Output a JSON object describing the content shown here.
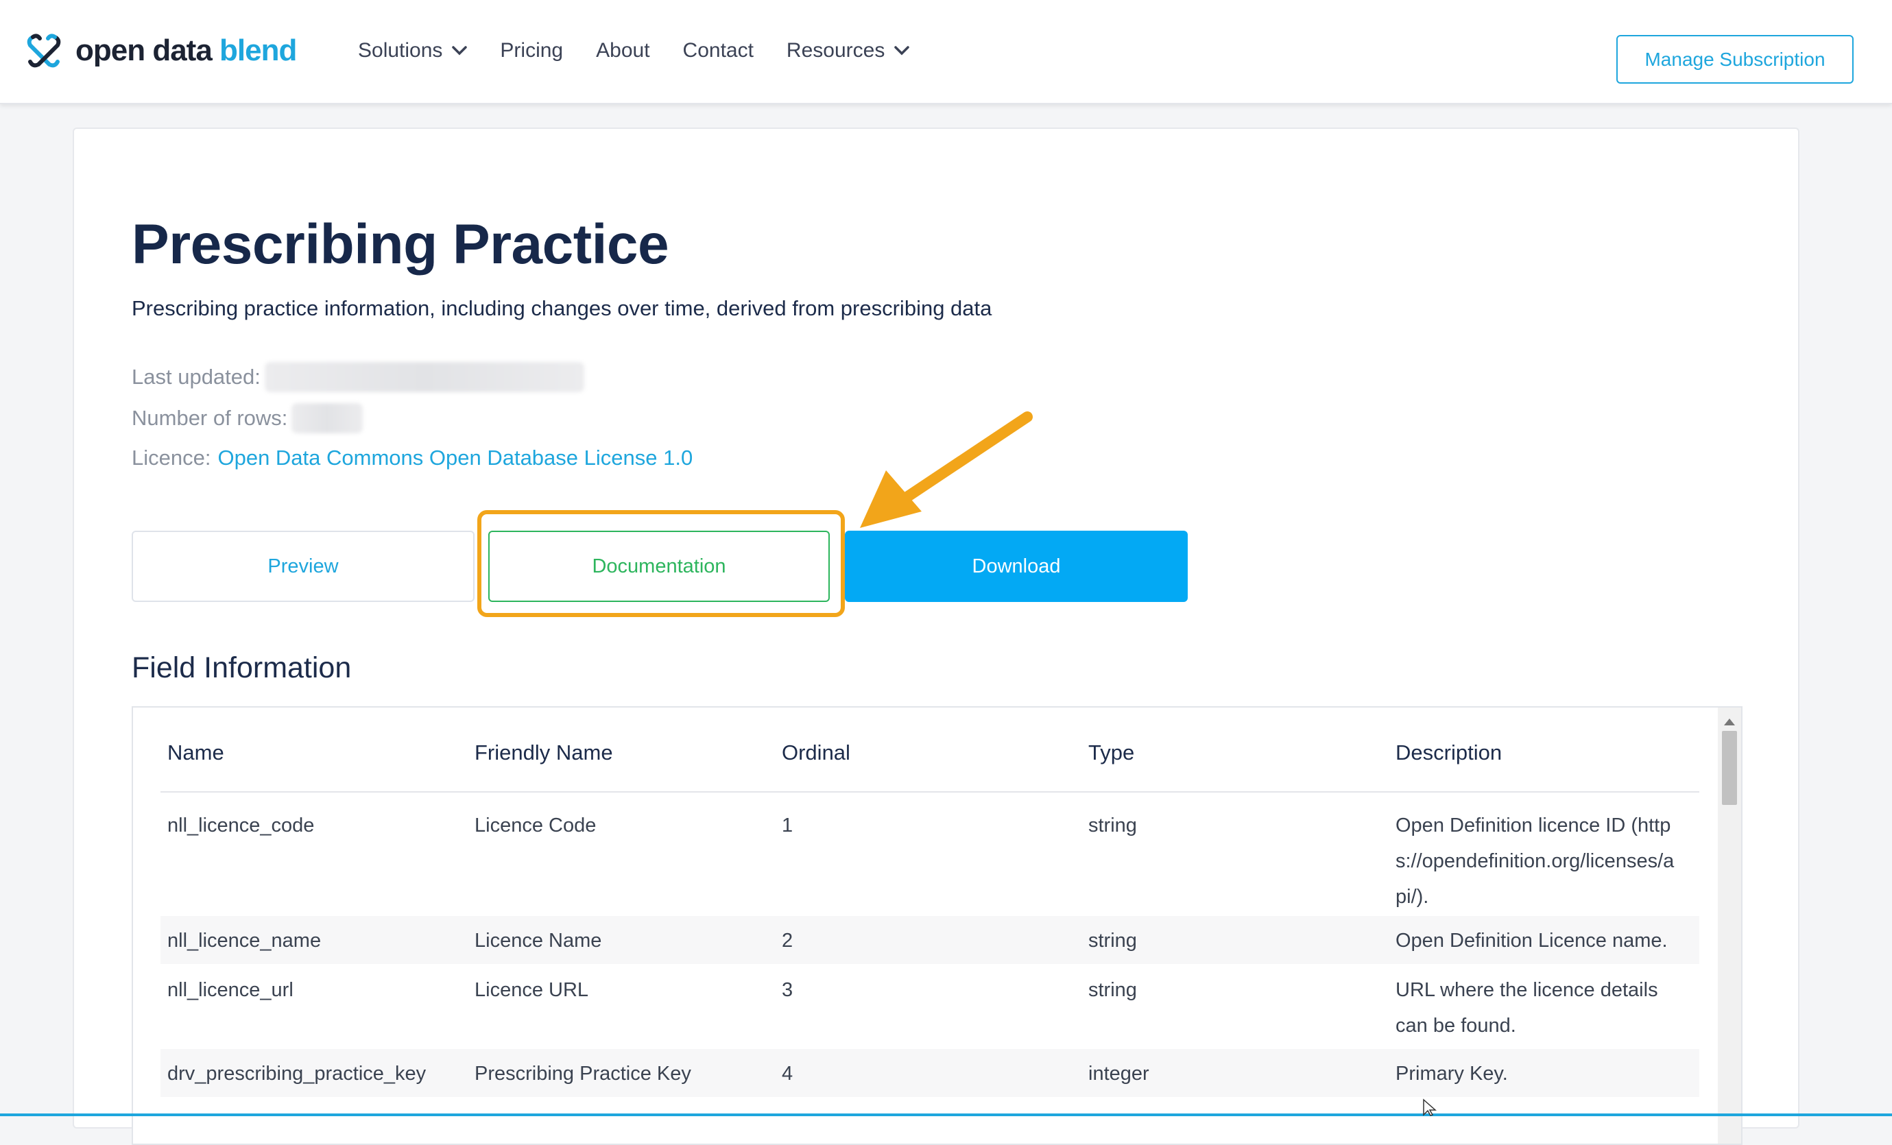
{
  "brand": {
    "name_part1": "open data ",
    "name_part2": "blend",
    "accent_color": "#1ea6dd"
  },
  "nav": {
    "items": [
      {
        "label": "Solutions",
        "dropdown": true
      },
      {
        "label": "Pricing",
        "dropdown": false
      },
      {
        "label": "About",
        "dropdown": false
      },
      {
        "label": "Contact",
        "dropdown": false
      },
      {
        "label": "Resources",
        "dropdown": true
      }
    ],
    "manage_subscription": "Manage Subscription"
  },
  "dataset": {
    "title": "Prescribing Practice",
    "description": "Prescribing practice information, including changes over time, derived from prescribing data",
    "last_updated_label": "Last updated:",
    "rows_label": "Number of rows:",
    "licence_label": "Licence:",
    "licence_link": "Open Data Commons Open Database License 1.0"
  },
  "actions": {
    "preview": "Preview",
    "documentation": "Documentation",
    "download": "Download",
    "highlight_color": "#f2a51a",
    "download_color": "#03a9f4",
    "documentation_color": "#2db55d"
  },
  "fields": {
    "heading": "Field Information",
    "columns": [
      "Name",
      "Friendly Name",
      "Ordinal",
      "Type",
      "Description"
    ],
    "rows": [
      {
        "name": "nll_licence_code",
        "friendly": "Licence Code",
        "ordinal": "1",
        "type": "string",
        "description": "Open Definition licence ID (https://opendefinition.org/licenses/api/)."
      },
      {
        "name": "nll_licence_name",
        "friendly": "Licence Name",
        "ordinal": "2",
        "type": "string",
        "description": "Open Definition Licence name."
      },
      {
        "name": "nll_licence_url",
        "friendly": "Licence URL",
        "ordinal": "3",
        "type": "string",
        "description": "URL where the licence details can be found."
      },
      {
        "name": "drv_prescribing_practice_key",
        "friendly": "Prescribing Practice Key",
        "ordinal": "4",
        "type": "integer",
        "description": "Primary Key."
      }
    ]
  }
}
